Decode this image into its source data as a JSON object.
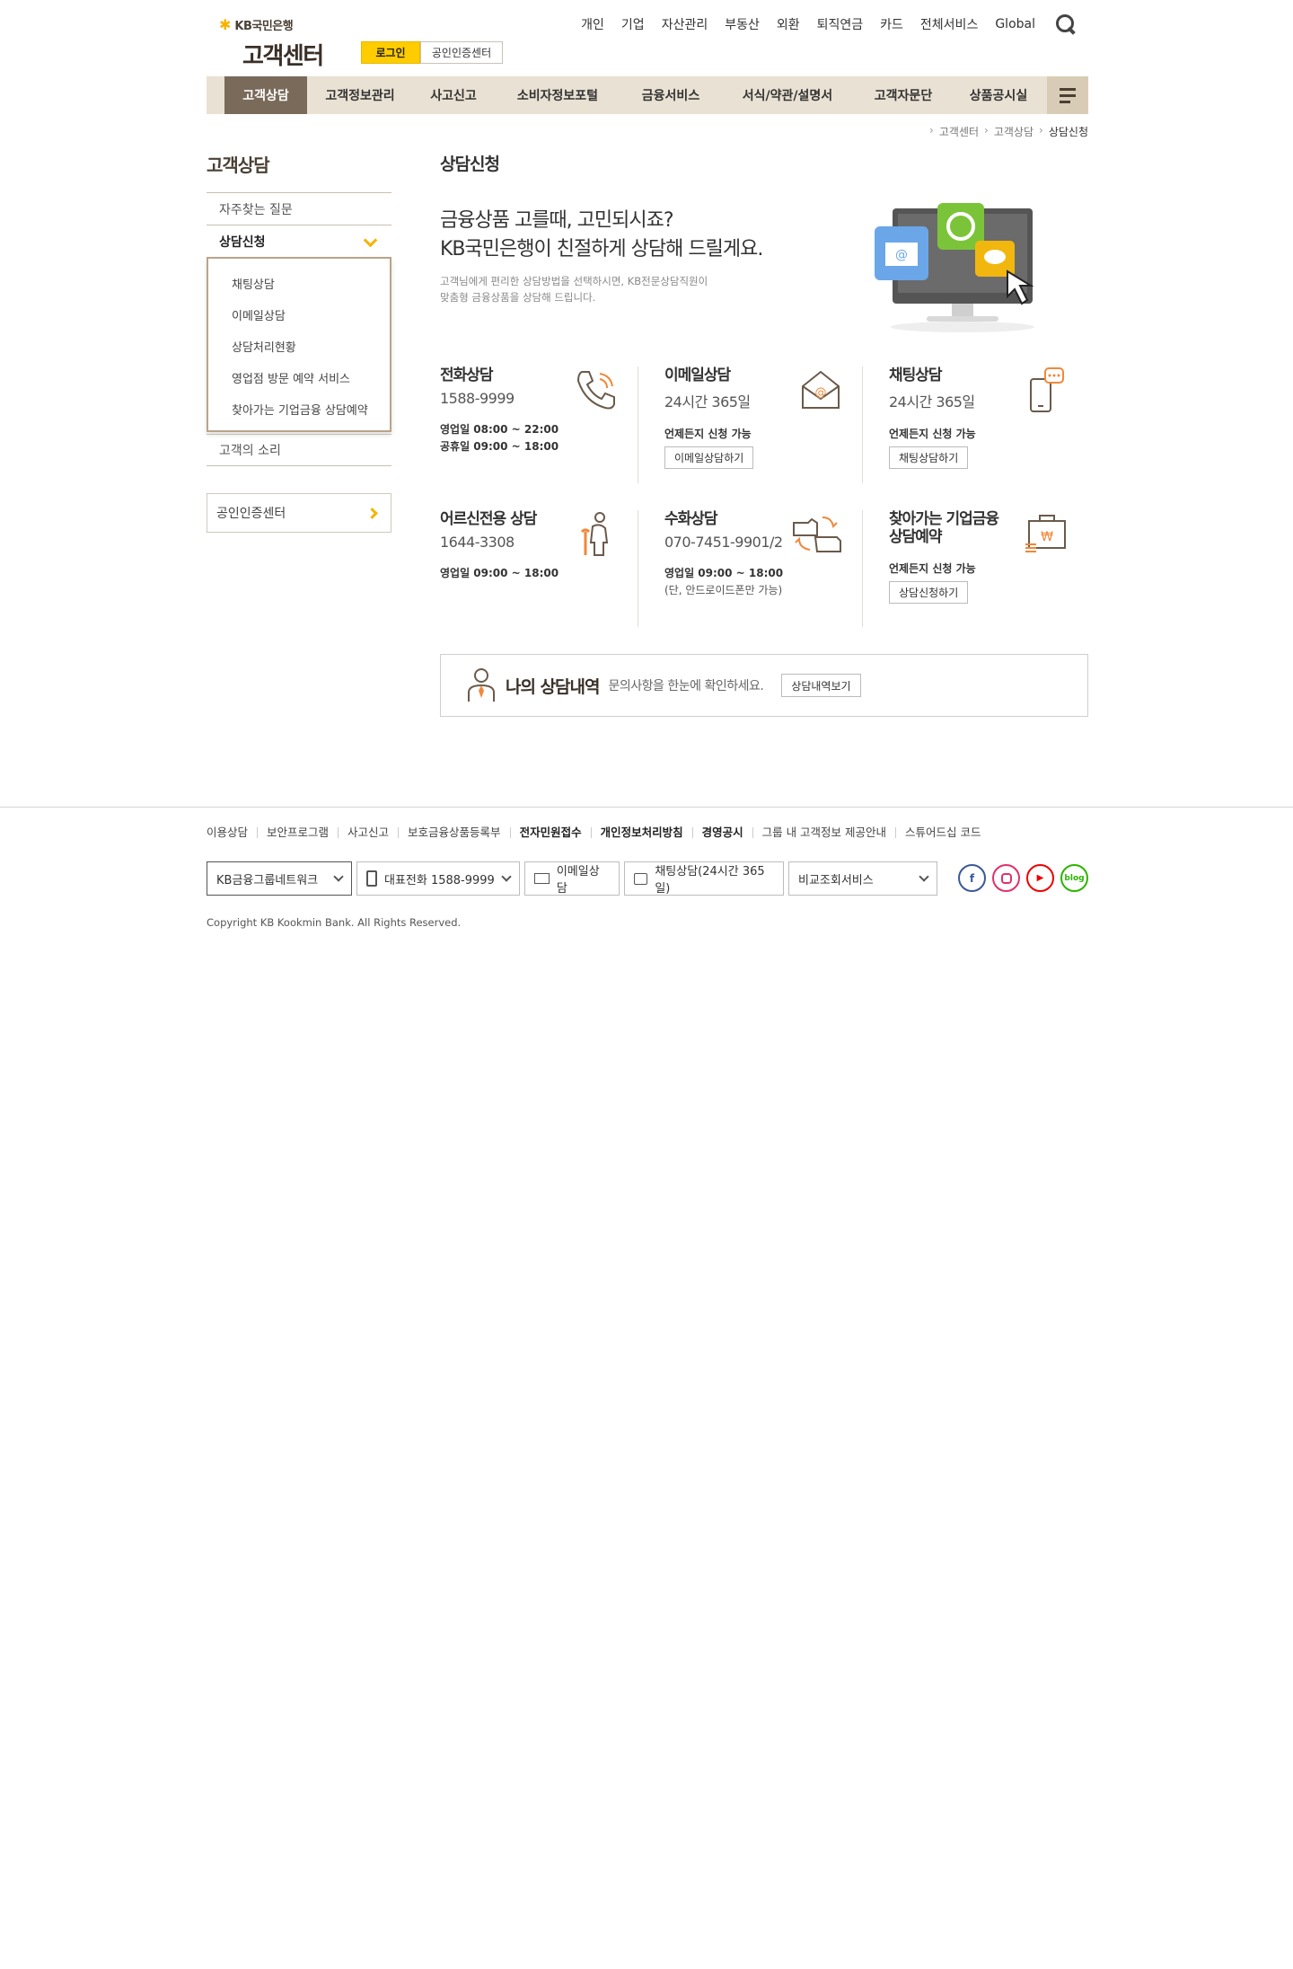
{
  "header": {
    "brand": "KB국민은행",
    "site_title": "고객센터",
    "login_label": "로그인",
    "cert_label": "공인인증센터",
    "top_nav": [
      "개인",
      "기업",
      "자산관리",
      "부동산",
      "외환",
      "퇴직연금",
      "카드",
      "전체서비스",
      "Global"
    ]
  },
  "gnb": {
    "items": [
      "고객상담",
      "고객정보관리",
      "사고신고",
      "소비자정보포털",
      "금융서비스",
      "서식/약관/설명서",
      "고객자문단",
      "상품공시실"
    ]
  },
  "breadcrumb": [
    "고객센터",
    "고객상담",
    "상담신청"
  ],
  "lnb": {
    "title": "고객상담",
    "items": [
      "자주찾는 질문",
      "상담신청",
      "고객의 소리"
    ],
    "sub_items": [
      "채팅상담",
      "이메일상담",
      "상담처리현황",
      "영업점 방문 예약 서비스",
      "찾아가는 기업금융 상담예약"
    ],
    "cert_label": "공인인증센터"
  },
  "content": {
    "page_title": "상담신청",
    "intro_line1": "금융상품 고를때, 고민되시죠?",
    "intro_line2": "KB국민은행이 친절하게 상담해 드릴게요.",
    "intro_desc1": "고객님에게 편리한 상담방법을 선택하시면, KB전문상담직원이",
    "intro_desc2": "맞춤형 금융상품을 상담해 드립니다.",
    "channels": [
      {
        "title": "전화상담",
        "sub": "1588-9999",
        "info1": "영업일 08:00 ~ 22:00",
        "info2": "공휴일 09:00 ~ 18:00"
      },
      {
        "title": "이메일상담",
        "sub": "24시간 365일",
        "info1": "언제든지 신청 가능",
        "button": "이메일상담하기"
      },
      {
        "title": "채팅상담",
        "sub": "24시간 365일",
        "info1": "언제든지 신청 가능",
        "button": "채팅상담하기"
      },
      {
        "title": "어르신전용 상담",
        "sub": "1644-3308",
        "info1": "영업일 09:00 ~ 18:00"
      },
      {
        "title": "수화상담",
        "sub": "070-7451-9901/2",
        "info1": "영업일 09:00 ~ 18:00",
        "note": "(단, 안드로이드폰만 가능)"
      },
      {
        "title": "찾아가는 기업금융",
        "title2": "상담예약",
        "info1": "언제든지 신청 가능",
        "button": "상담신청하기"
      }
    ],
    "history": {
      "title": "나의 상담내역",
      "desc": "문의사항을 한눈에 확인하세요.",
      "button": "상담내역보기"
    }
  },
  "footer": {
    "links": [
      {
        "label": "이용상담",
        "bold": false
      },
      {
        "label": "보안프로그램",
        "bold": false
      },
      {
        "label": "사고신고",
        "bold": false
      },
      {
        "label": "보호금융상품등록부",
        "bold": false
      },
      {
        "label": "전자민원접수",
        "bold": true
      },
      {
        "label": "개인정보처리방침",
        "bold": true
      },
      {
        "label": "경영공시",
        "bold": true
      },
      {
        "label": "그룹 내 고객정보 제공안내",
        "bold": false
      },
      {
        "label": "스튜어드십 코드",
        "bold": false
      }
    ],
    "tools": {
      "network": "KB금융그룹네트워크",
      "phone": "대표전화 1588-9999",
      "email": "이메일상담",
      "chat": "채팅상담(24시간 365일)",
      "compare": "비교조회서비스"
    },
    "sns": [
      "facebook-icon",
      "instagram-icon",
      "youtube-icon",
      "blog-icon"
    ],
    "sns_blog_label": "blog",
    "copyright": "Copyright KB Kookmin Bank. All Rights Reserved."
  },
  "colors": {
    "accent_yellow": "#ffcc00",
    "gnb_bg": "#e9e1d3",
    "gnb_active": "#7a6a5a",
    "brown_text": "#4a4035"
  }
}
